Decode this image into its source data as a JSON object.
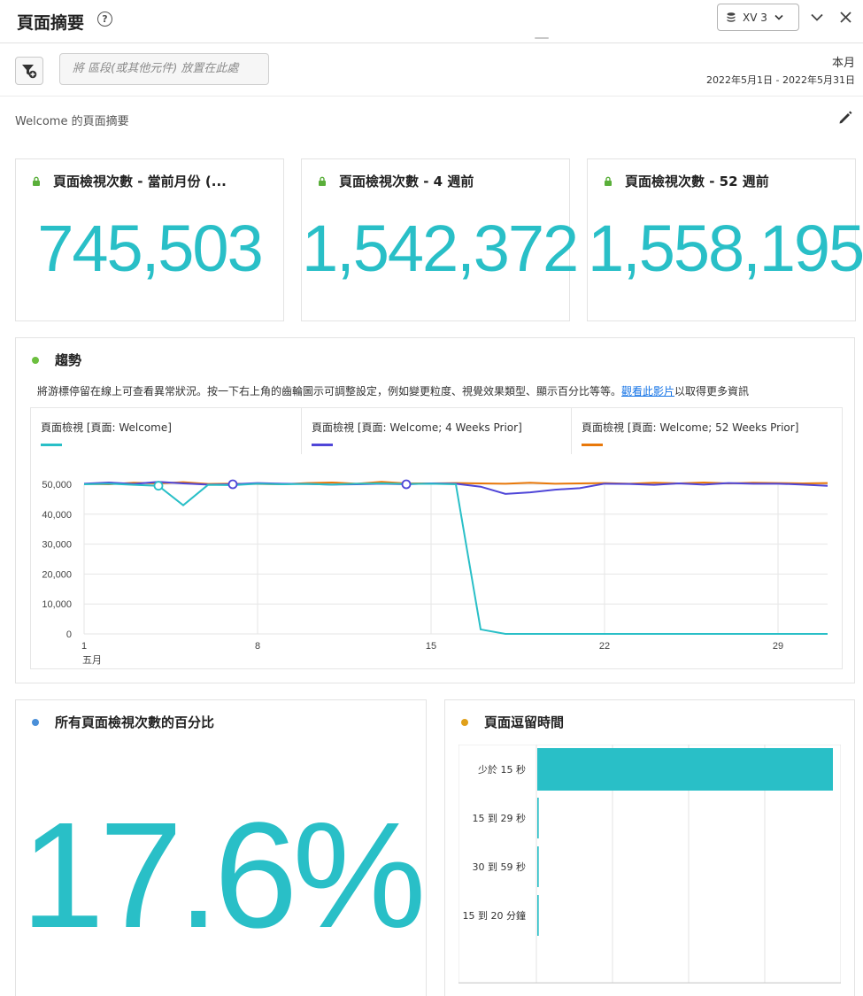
{
  "header": {
    "title": "頁面摘要",
    "help_icon": "?",
    "datasource_label": "XV 3"
  },
  "segment_bar": {
    "dropzone_placeholder": "將 區段(或其他元件) 放置在此處",
    "period_label": "本月",
    "date_range": "2022年5月1日 - 2022年5月31日"
  },
  "panel": {
    "title": "Welcome 的頁面摘要"
  },
  "kpis": [
    {
      "title": "頁面檢視次數 - 當前月份 (...",
      "value": "745,503"
    },
    {
      "title": "頁面檢視次數 - 4 週前",
      "value": "1,542,372"
    },
    {
      "title": "頁面檢視次數 - 52 週前",
      "value": "1,558,195"
    }
  ],
  "trend": {
    "title": "趨勢",
    "description_prefix": "將游標停留在線上可查看異常狀況。按一下右上角的齒輪圖示可調整設定，例如變更粒度、視覺效果類型、顯示百分比等等。",
    "link_text": "觀看此影片",
    "description_suffix": "以取得更多資訊",
    "dot_color": "#6cbf3f"
  },
  "percent_panel": {
    "title": "所有頁面檢視次數的百分比",
    "value": "17.6%",
    "dot_color": "#4a8fd8"
  },
  "time_panel": {
    "title": "頁面逗留時間",
    "dot_color": "#e0a01a"
  },
  "chart_data": [
    {
      "type": "line",
      "series": [
        {
          "name": "頁面檢視 [頁面: Welcome]",
          "color": "#29bfc7",
          "values": [
            50000,
            50200,
            49800,
            49500,
            43000,
            49800,
            49700,
            50200,
            50000,
            50100,
            49900,
            50200,
            50300,
            50100,
            50200,
            50000,
            1500,
            0,
            0,
            0,
            0,
            0,
            0,
            0,
            0,
            0,
            0,
            0,
            0,
            0,
            0
          ]
        },
        {
          "name": "頁面檢視 [頁面: Welcome; 4 Weeks Prior]",
          "color": "#4f46d8",
          "values": [
            50200,
            50600,
            50100,
            50800,
            50300,
            49900,
            50000,
            50400,
            50200,
            50100,
            49900,
            50000,
            50200,
            50000,
            50300,
            50200,
            49200,
            46800,
            47300,
            48200,
            48700,
            50200,
            50100,
            49800,
            50300,
            49900,
            50400,
            50200,
            50200,
            49900,
            49500
          ]
        },
        {
          "name": "頁面檢視 [頁面: Welcome; 52 Weeks Prior]",
          "color": "#e8780a",
          "values": [
            50100,
            50000,
            50500,
            50300,
            50700,
            50100,
            50200,
            50100,
            50000,
            50400,
            50600,
            50200,
            50800,
            50300,
            50300,
            50400,
            50300,
            50200,
            50500,
            50200,
            50300,
            50400,
            50200,
            50500,
            50300,
            50600,
            50300,
            50500,
            50400,
            50300,
            50400
          ]
        }
      ],
      "x": [
        1,
        2,
        3,
        4,
        5,
        6,
        7,
        8,
        9,
        10,
        11,
        12,
        13,
        14,
        15,
        16,
        17,
        18,
        19,
        20,
        21,
        22,
        23,
        24,
        25,
        26,
        27,
        28,
        29,
        30,
        31
      ],
      "x_ticks": [
        "1",
        "8",
        "15",
        "22",
        "29"
      ],
      "x_month_label": "五月",
      "y_ticks": [
        "0",
        "10,000",
        "20,000",
        "30,000",
        "40,000",
        "50,000"
      ],
      "ylim": [
        0,
        50000
      ],
      "markers": [
        {
          "series": 0,
          "x": 4,
          "style": "hollow"
        },
        {
          "series": 1,
          "x": 7,
          "style": "hollow"
        },
        {
          "series": 1,
          "x": 14,
          "style": "hollow"
        }
      ],
      "grid": true,
      "legend": "top"
    },
    {
      "type": "bar",
      "orientation": "horizontal",
      "categories": [
        "少於 15 秒",
        "15 到 29 秒",
        "30 到 59 秒",
        "15 到 20 分鐘"
      ],
      "values": [
        100,
        0.5,
        0.5,
        0.5
      ],
      "color": "#29bfc7",
      "grid": true
    }
  ]
}
